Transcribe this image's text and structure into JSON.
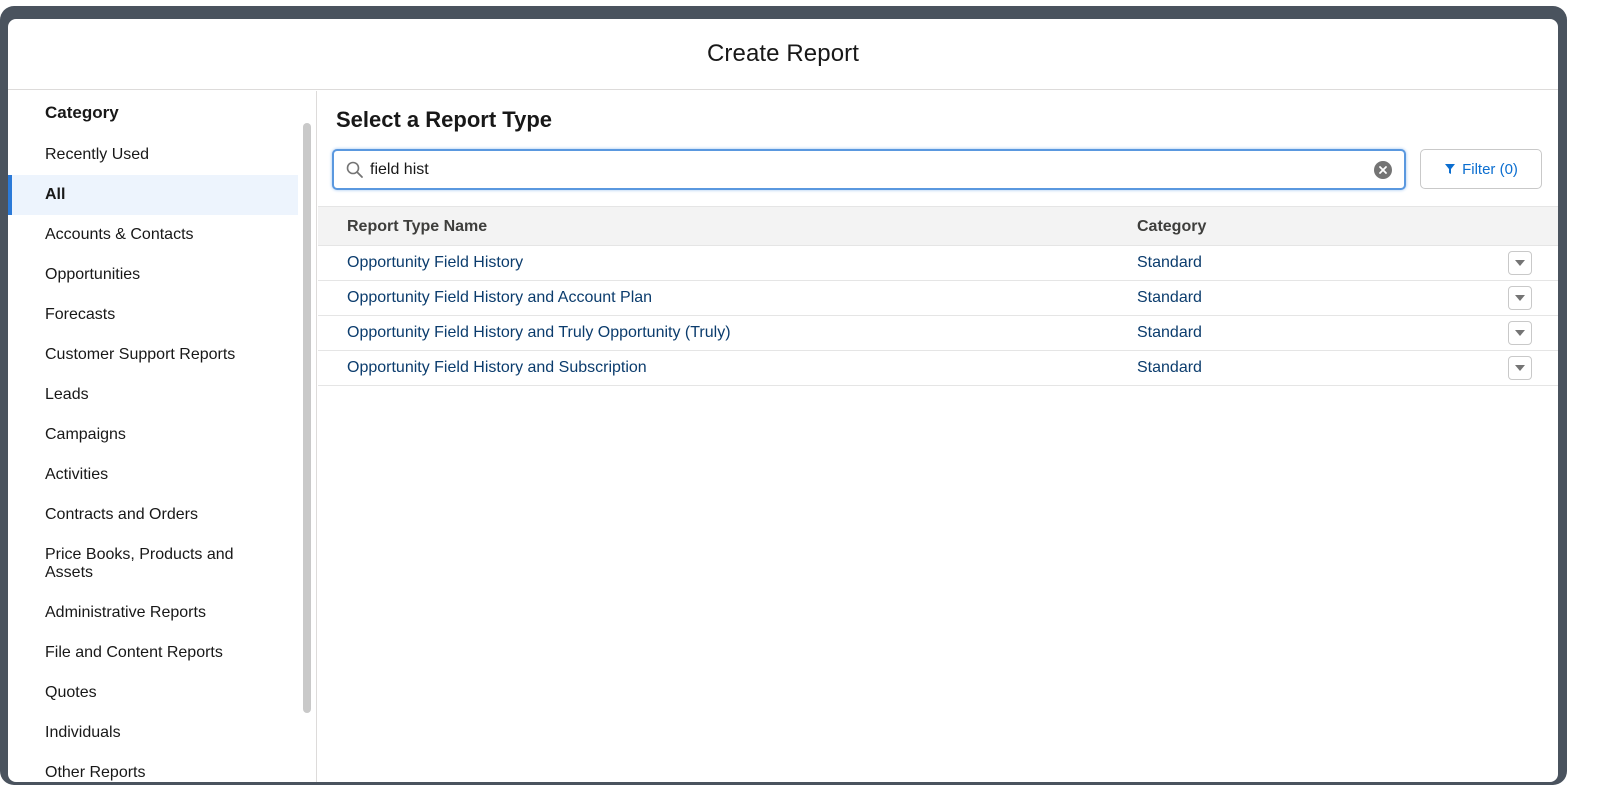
{
  "modal": {
    "title": "Create Report"
  },
  "sidebar": {
    "heading": "Category",
    "items": [
      {
        "label": "Recently Used",
        "active": false
      },
      {
        "label": "All",
        "active": true
      },
      {
        "label": "Accounts & Contacts",
        "active": false
      },
      {
        "label": "Opportunities",
        "active": false
      },
      {
        "label": "Forecasts",
        "active": false
      },
      {
        "label": "Customer Support Reports",
        "active": false
      },
      {
        "label": "Leads",
        "active": false
      },
      {
        "label": "Campaigns",
        "active": false
      },
      {
        "label": "Activities",
        "active": false
      },
      {
        "label": "Contracts and Orders",
        "active": false
      },
      {
        "label": "Price Books, Products and Assets",
        "active": false
      },
      {
        "label": "Administrative Reports",
        "active": false
      },
      {
        "label": "File and Content Reports",
        "active": false
      },
      {
        "label": "Quotes",
        "active": false
      },
      {
        "label": "Individuals",
        "active": false
      },
      {
        "label": "Other Reports",
        "active": false
      }
    ]
  },
  "main": {
    "heading": "Select a Report Type",
    "search": {
      "value": "field hist",
      "placeholder": ""
    },
    "filter_label": "Filter (0)",
    "table": {
      "columns": [
        "Report Type Name",
        "Category"
      ],
      "rows": [
        {
          "name": "Opportunity Field History",
          "category": "Standard"
        },
        {
          "name": "Opportunity Field History and Account Plan",
          "category": "Standard"
        },
        {
          "name": "Opportunity Field History and Truly Opportunity (Truly)",
          "category": "Standard"
        },
        {
          "name": "Opportunity Field History and Subscription",
          "category": "Standard"
        }
      ]
    }
  },
  "colors": {
    "accent": "#2b7ad8",
    "link": "#0b3c6d",
    "active_bg": "#edf4fd",
    "frame": "#4a535e"
  },
  "icons": {
    "search": "search-icon",
    "clear": "clear-icon",
    "filter": "filter-icon",
    "row_menu": "chevron-down-icon"
  }
}
